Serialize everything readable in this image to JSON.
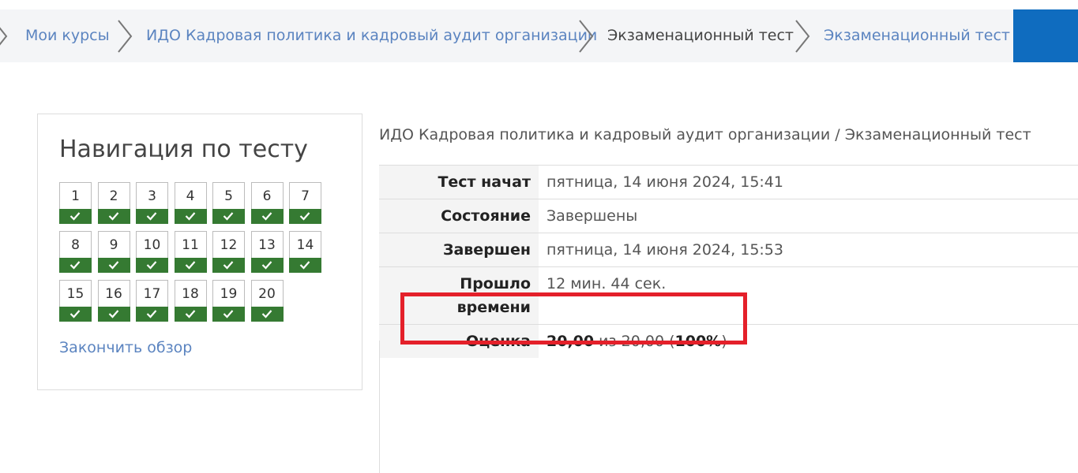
{
  "breadcrumb": {
    "items": [
      {
        "label": "Мои курсы"
      },
      {
        "label": "ИДО Кадровая политика и кадровый аудит организации"
      },
      {
        "label": "Экзаменационный тест"
      },
      {
        "label": "Экзаменационный тест"
      }
    ]
  },
  "navigation": {
    "title": "Навигация по тесту",
    "questions": [
      "1",
      "2",
      "3",
      "4",
      "5",
      "6",
      "7",
      "8",
      "9",
      "10",
      "11",
      "12",
      "13",
      "14",
      "15",
      "16",
      "17",
      "18",
      "19",
      "20"
    ],
    "finish_review": "Закончить обзор",
    "state_color": "#357a32"
  },
  "main": {
    "course": "ИДО Кадровая политика и кадровый аудит организации",
    "separator": "/",
    "quiz": "Экзаменационный тест"
  },
  "summary": {
    "started_label": "Тест начат",
    "started_value": "пятница, 14 июня 2024, 15:41",
    "state_label": "Состояние",
    "state_value": "Завершены",
    "completed_label": "Завершен",
    "completed_value": "пятница, 14 июня 2024, 15:53",
    "elapsed_label_1": "Прошло",
    "elapsed_label_2": "времени",
    "elapsed_value": "12 мин. 44 сек.",
    "grade_label": "Оценка",
    "grade_score": "20,00",
    "grade_of": "из 20,00 (",
    "grade_percent": "100%",
    "grade_close": ")"
  },
  "colors": {
    "link": "#5b84c0",
    "accent_blue": "#0f6cbf",
    "highlight": "#e4202a"
  }
}
